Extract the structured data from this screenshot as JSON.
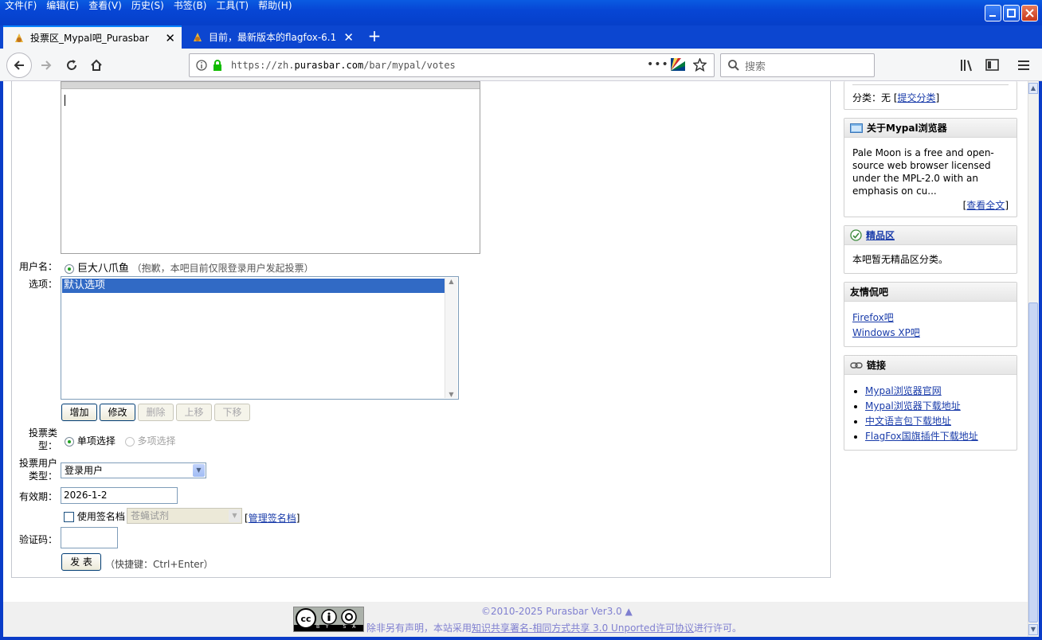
{
  "menu": [
    "文件(F)",
    "编辑(E)",
    "查看(V)",
    "历史(S)",
    "书签(B)",
    "工具(T)",
    "帮助(H)"
  ],
  "tabs": [
    {
      "label": "投票区_Mypal吧_Purasbar",
      "active": true
    },
    {
      "label": "目前，最新版本的flagfox-6.1",
      "active": false
    }
  ],
  "address": {
    "prefix": "https://zh.",
    "host": "purasbar.com",
    "path": "/bar/mypal/votes"
  },
  "search": {
    "placeholder": "搜索"
  },
  "form": {
    "username_label": "用户名：",
    "username_value": "巨大八爪鱼",
    "username_note": "（抱歉，本吧目前仅限登录用户发起投票）",
    "options_label": "选项：",
    "options_selected": "默认选项",
    "buttons": {
      "add": "增加",
      "edit": "修改",
      "delete": "删除",
      "up": "上移",
      "down": "下移"
    },
    "vote_type_label_1": "投票类",
    "vote_type_label_2": "型：",
    "vote_single": "单项选择",
    "vote_multi": "多项选择",
    "user_type_label_1": "投票用户",
    "user_type_label_2": "类型：",
    "user_type_value": "登录用户",
    "expire_label": "有效期：",
    "expire_value": "2026-1-2",
    "signature_check": "使用签名档",
    "signature_value": "苍蝇试剂",
    "signature_manage": "管理签名档",
    "captcha_label": "验证码：",
    "submit": "发 表",
    "shortcut": "（快捷键：Ctrl+Enter）"
  },
  "sidebar": {
    "category_prefix": "分类：无 [",
    "category_link": "提交分类",
    "category_suffix": "]",
    "about_title": "关于Mypal浏览器",
    "about_text": "Pale Moon is a free and open-source web browser licensed under the MPL-2.0 with an emphasis on cu...",
    "about_more": "查看全文",
    "featured_title": "精品区",
    "featured_text": "本吧暂无精品区分类。",
    "friends_title": "友情侃吧",
    "friends": [
      "Firefox吧",
      "Windows XP吧"
    ],
    "links_title": "链接",
    "links": [
      "Mypal浏览器官网",
      "Mypal浏览器下载地址",
      "中文语言包下载地址",
      "FlagFox国旗插件下载地址"
    ]
  },
  "footer": {
    "copyright": "©2010-2025 Purasbar Ver3.0 ▲",
    "license_prefix": "除非另有声明，本站采用",
    "license_link": "知识共享署名-相同方式共享 3.0 Unported许可协议",
    "license_suffix": "进行许可。",
    "cc_badge": "BY SA"
  }
}
